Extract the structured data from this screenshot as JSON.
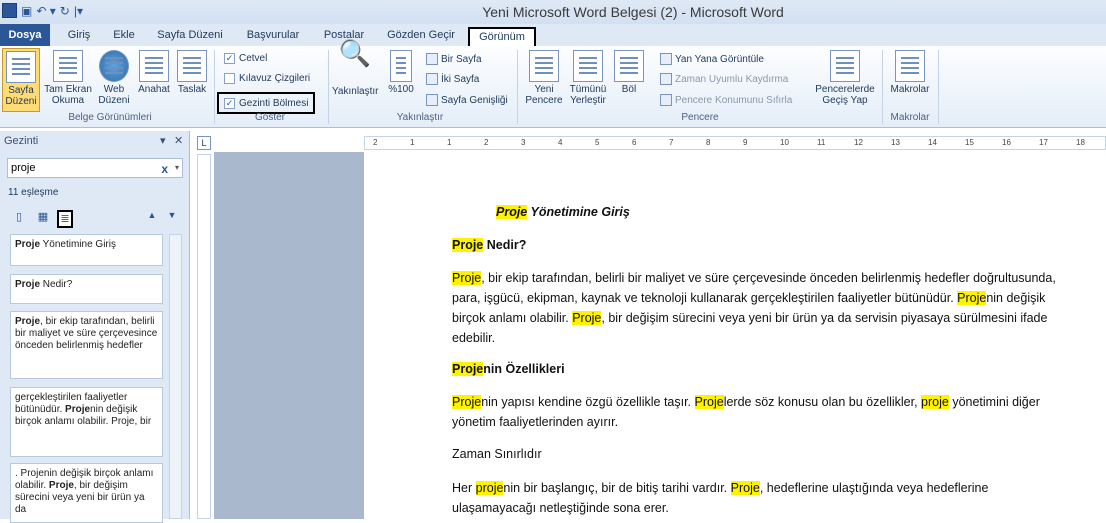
{
  "window": {
    "title": "Yeni Microsoft Word Belgesi (2)  -  Microsoft Word",
    "app_icon": "W"
  },
  "tabs": [
    "Dosya",
    "Giriş",
    "Ekle",
    "Sayfa Düzeni",
    "Başvurular",
    "Postalar",
    "Gözden Geçir",
    "Görünüm"
  ],
  "ribbon": {
    "belge": {
      "label": "Belge Görünümleri",
      "buttons": [
        "Sayfa Düzeni",
        "Tam Ekran Okuma",
        "Web Düzeni",
        "Anahat",
        "Taslak"
      ]
    },
    "goster": {
      "label": "Göster",
      "items": [
        "Cetvel",
        "Kılavuz Çizgileri",
        "Gezinti Bölmesi"
      ]
    },
    "yakinlastir": {
      "label": "Yakınlaştır",
      "zoom": "Yakınlaştır",
      "percent": "%100",
      "small": [
        "Bir Sayfa",
        "İki Sayfa",
        "Sayfa Genişliği"
      ]
    },
    "pencere": {
      "label": "Pencere",
      "buttons": [
        "Yeni Pencere",
        "Tümünü Yerleştir",
        "Böl"
      ],
      "small": [
        "Yan Yana Görüntüle",
        "Zaman Uyumlu Kaydırma",
        "Pencere Konumunu Sıfırla"
      ],
      "switch": "Pencerelerde Geçiş Yap"
    },
    "makrolar": {
      "label": "Makrolar",
      "button": "Makrolar"
    }
  },
  "nav": {
    "title": "Gezinti",
    "search_value": "proje",
    "matches": "11 eşleşme"
  },
  "results": [
    {
      "hl": "Proje",
      "rest": " Yönetimine Giriş"
    },
    {
      "hl": "Proje",
      "rest": " Nedir?"
    },
    {
      "hl": "Proje",
      "rest": ", bir ekip tarafından, belirli bir maliyet ve süre çerçevesince önceden belirlenmiş hedefler"
    },
    {
      "pre": "gerçekleştirilen faaliyetler bütünüdür. ",
      "hl": "Proje",
      "rest": "nin değişik birçok anlamı olabilir. Proje, bir"
    },
    {
      "pre": ". Projenin değişik birçok anlamı olabilir. ",
      "hl": "Proje",
      "rest": ", bir değişim sürecini veya yeni bir ürün ya da"
    }
  ],
  "ruler": [
    "2",
    "1",
    "1",
    "2",
    "3",
    "4",
    "5",
    "6",
    "7",
    "8",
    "9",
    "10",
    "11",
    "12",
    "13",
    "14",
    "15",
    "16",
    "17",
    "18"
  ],
  "doc": {
    "title_hl": "Proje",
    "title_rest": " Yönetimine Giriş",
    "h1_hl": "Proje",
    "h1_rest": " Nedir?",
    "p1": [
      {
        "t": "Proje",
        "h": true
      },
      {
        "t": ", bir ekip tarafından, belirli bir maliyet ve süre çerçevesinde önceden belirlenmiş hedefler doğrultusunda, para, işgücü, ekipman, kaynak ve teknoloji kullanarak gerçekleştirilen faaliyetler bütünüdür. "
      },
      {
        "t": "Proje",
        "h": true
      },
      {
        "t": "nin değişik birçok anlamı olabilir. "
      },
      {
        "t": "Proje",
        "h": true
      },
      {
        "t": ", bir değişim sürecini veya yeni bir ürün ya da servisin piyasaya sürülmesini ifade edebilir."
      }
    ],
    "h2_hl": "Proje",
    "h2_rest": "nin Özellikleri",
    "p2": [
      {
        "t": "Proje",
        "h": true
      },
      {
        "t": "nin yapısı kendine özgü özellikle taşır. "
      },
      {
        "t": "Proje",
        "h": true
      },
      {
        "t": "lerde söz konusu olan bu özellikler, "
      },
      {
        "t": "proje",
        "h": true
      },
      {
        "t": " yönetimini diğer yönetim faaliyetlerinden ayırır."
      }
    ],
    "p3": "Zaman Sınırlıdır",
    "p4": [
      {
        "t": "Her "
      },
      {
        "t": "proje",
        "h": true
      },
      {
        "t": "nin bir başlangıç, bir de bitiş tarihi vardır. "
      },
      {
        "t": "Proje",
        "h": true
      },
      {
        "t": ", hedeflerine ulaştığında veya hedeflerine ulaşamayacağı netleştiğinde sona erer."
      }
    ]
  }
}
